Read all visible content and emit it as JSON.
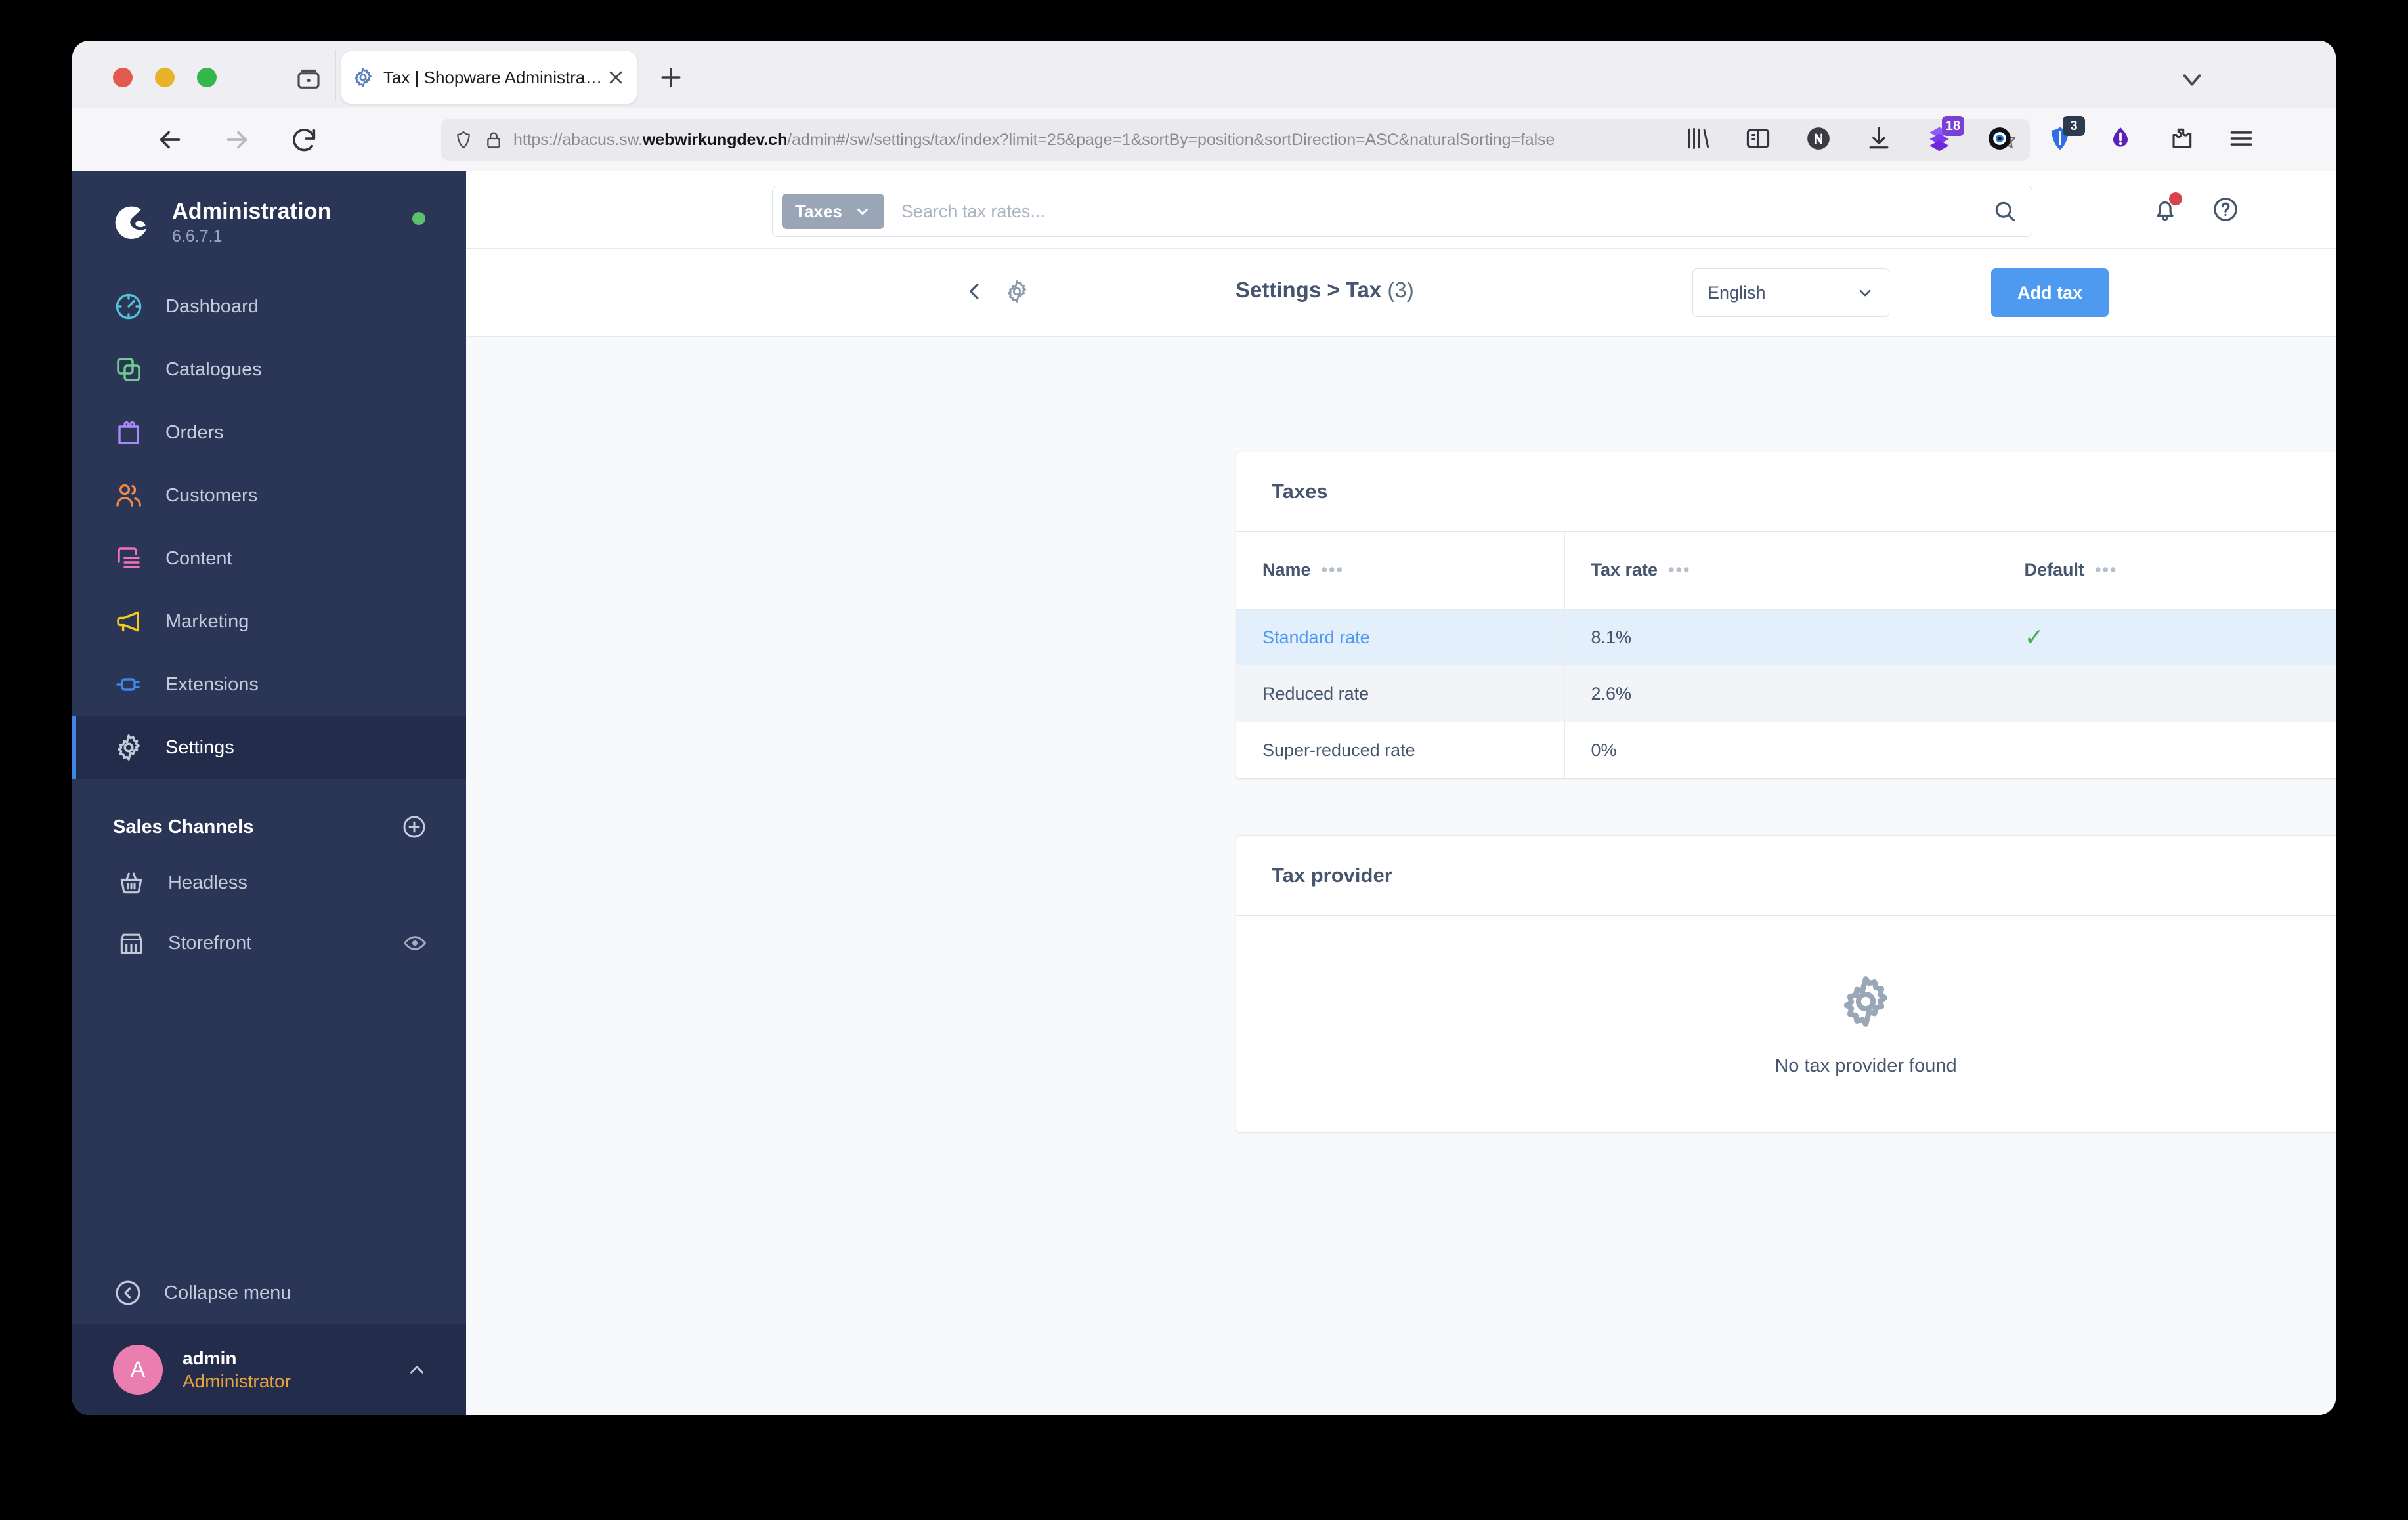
{
  "browser": {
    "tab": {
      "title": "Tax | Shopware Administration",
      "favicon": "gear-icon"
    },
    "url_prefix": "https://abacus.sw.",
    "url_domain": "webwirkungdev.ch",
    "url_suffix": "/admin#/sw/settings/tax/index?limit=25&page=1&sortBy=position&sortDirection=ASC&naturalSorting=false",
    "extensions": [
      {
        "name": "library-icon",
        "badge": ""
      },
      {
        "name": "sidebar-icon",
        "badge": ""
      },
      {
        "name": "notion-icon",
        "badge": ""
      },
      {
        "name": "download-icon",
        "badge": ""
      },
      {
        "name": "stacked-layers-icon",
        "badge": "18"
      },
      {
        "name": "eye-icon",
        "badge": ""
      },
      {
        "name": "shield-icon",
        "badge": "3"
      },
      {
        "name": "drop-icon",
        "badge": ""
      },
      {
        "name": "puzzle-icon",
        "badge": ""
      },
      {
        "name": "menu-icon",
        "badge": ""
      }
    ]
  },
  "sidebar": {
    "brand": {
      "title": "Administration",
      "version": "6.6.7.1"
    },
    "items": [
      {
        "label": "Dashboard",
        "icon": "gauge-icon",
        "color": "#53c1d8",
        "active": false
      },
      {
        "label": "Catalogues",
        "icon": "copy-icon",
        "color": "#6fce8d",
        "active": false
      },
      {
        "label": "Orders",
        "icon": "bag-icon",
        "color": "#a78bfa",
        "active": false
      },
      {
        "label": "Customers",
        "icon": "users-icon",
        "color": "#f08a48",
        "active": false
      },
      {
        "label": "Content",
        "icon": "content-icon",
        "color": "#f472b6",
        "active": false
      },
      {
        "label": "Marketing",
        "icon": "megaphone-icon",
        "color": "#f2cb1e",
        "active": false
      },
      {
        "label": "Extensions",
        "icon": "plug-icon",
        "color": "#3f85ea",
        "active": false
      },
      {
        "label": "Settings",
        "icon": "gear-icon",
        "color": "#c3cad9",
        "active": true
      }
    ],
    "sales_channels": {
      "heading": "Sales Channels",
      "add_label": "plus-circle-icon",
      "items": [
        {
          "label": "Headless",
          "icon": "basket-icon",
          "has_eye": false
        },
        {
          "label": "Storefront",
          "icon": "store-icon",
          "has_eye": true
        }
      ]
    },
    "collapse_label": "Collapse menu",
    "user": {
      "initial": "A",
      "name": "admin",
      "role": "Administrator"
    }
  },
  "search": {
    "scope_label": "Taxes",
    "placeholder": "Search tax rates...",
    "value": ""
  },
  "pagehead": {
    "breadcrumb": "Settings > Tax",
    "count": "(3)",
    "language": "English",
    "add_button": "Add tax"
  },
  "taxes_card": {
    "title": "Taxes",
    "columns": [
      "Name",
      "Tax rate",
      "Default"
    ],
    "rows": [
      {
        "name": "Standard rate",
        "rate": "8.1%",
        "default": true,
        "selected": true
      },
      {
        "name": "Reduced rate",
        "rate": "2.6%",
        "default": false,
        "selected": false
      },
      {
        "name": "Super-reduced rate",
        "rate": "0%",
        "default": false,
        "selected": false
      }
    ],
    "row_menu": "•••",
    "column_menu": "•••",
    "check_mark": "✓"
  },
  "provider_card": {
    "title": "Tax provider",
    "empty_text": "No tax provider found",
    "empty_icon": "gear-icon"
  },
  "colors": {
    "sidebar_bg": "#2b3657",
    "sidebar_active": "#232d4b",
    "accent_blue": "#4e9af1",
    "content_bg": "#f7f9fb",
    "row_selected": "#e4effc",
    "check_green": "#4caf50",
    "role_orange": "#e8a33d",
    "avatar_pink": "#ea7eb0",
    "status_green": "#5bc16a",
    "notification_red": "#d9434f"
  }
}
